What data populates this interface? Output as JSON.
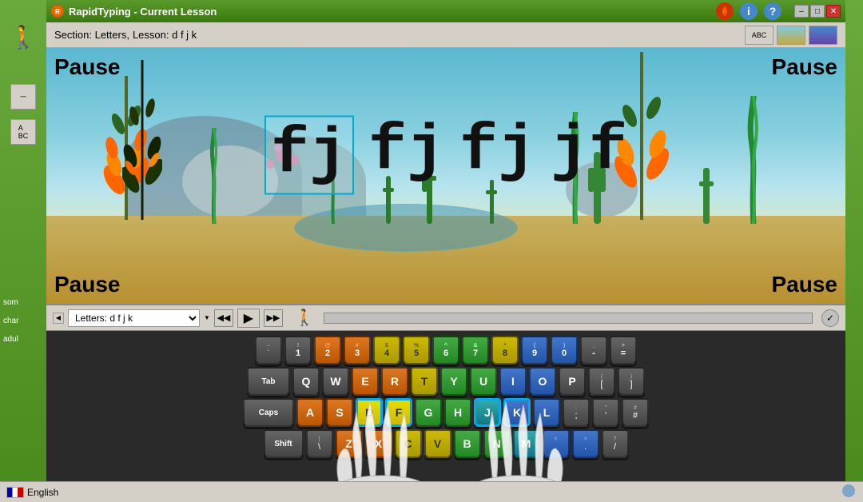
{
  "window": {
    "title": "RapidTyping - Current Lesson",
    "min": "–",
    "max": "□",
    "close": "✕"
  },
  "toolbar": {
    "section_label": "Section:  Letters,",
    "lesson_label": "Lesson: d f j k"
  },
  "scene": {
    "pause_labels": [
      "Pause",
      "Pause",
      "Pause",
      "Pause"
    ],
    "typing_words": [
      "fj",
      "fj",
      "fj",
      "jf"
    ]
  },
  "controls": {
    "lesson_value": "Letters: d f j k",
    "rewind": "◀◀",
    "play": "▶",
    "forward": "▶▶"
  },
  "keyboard": {
    "rows": [
      {
        "keys": [
          {
            "label": "~\n`",
            "top": "~",
            "main": "`",
            "color": "dark"
          },
          {
            "label": "!\n1",
            "top": "!",
            "main": "1",
            "color": "dark"
          },
          {
            "label": "@\n2",
            "top": "@",
            "main": "2",
            "color": "orange"
          },
          {
            "label": "#\n3",
            "top": "#",
            "main": "3",
            "color": "orange"
          },
          {
            "label": "$\n4",
            "top": "$",
            "main": "4",
            "color": "yellow"
          },
          {
            "label": "%\n5",
            "top": "%",
            "main": "5",
            "color": "yellow"
          },
          {
            "label": "^\n6",
            "top": "^",
            "main": "6",
            "color": "green"
          },
          {
            "label": "&\n7",
            "top": "&",
            "main": "7",
            "color": "green"
          },
          {
            "label": "*\n8",
            "top": "*",
            "main": "8",
            "color": "yellow"
          },
          {
            "label": "(\n9",
            "top": "(",
            "main": "9",
            "color": "blue"
          },
          {
            "label": ")\n0",
            "top": ")",
            "main": "0",
            "color": "blue"
          },
          {
            "label": "_\n-",
            "top": "_",
            "main": "-",
            "color": "dark"
          },
          {
            "label": "+\n=",
            "top": "+",
            "main": "=",
            "color": "dark"
          }
        ]
      },
      {
        "keys": [
          {
            "label": "Tab",
            "top": "",
            "main": "Tab",
            "color": "dark",
            "wide": true
          },
          {
            "label": "Q",
            "top": "",
            "main": "Q",
            "color": "dark"
          },
          {
            "label": "W",
            "top": "",
            "main": "W",
            "color": "dark"
          },
          {
            "label": "E",
            "top": "",
            "main": "E",
            "color": "orange"
          },
          {
            "label": "R",
            "top": "",
            "main": "R",
            "color": "orange"
          },
          {
            "label": "T",
            "top": "",
            "main": "T",
            "color": "yellow"
          },
          {
            "label": "Y",
            "top": "",
            "main": "Y",
            "color": "green"
          },
          {
            "label": "U",
            "top": "",
            "main": "U",
            "color": "green"
          },
          {
            "label": "I",
            "top": "",
            "main": "I",
            "color": "blue"
          },
          {
            "label": "O",
            "top": "",
            "main": "O",
            "color": "blue"
          },
          {
            "label": "P",
            "top": "",
            "main": "P",
            "color": "dark"
          },
          {
            "label": "[\n{",
            "top": "{",
            "main": "[",
            "color": "dark"
          },
          {
            "label": "]\n}",
            "top": "}",
            "main": "]",
            "color": "dark"
          }
        ]
      },
      {
        "keys": [
          {
            "label": "Caps",
            "top": "",
            "main": "Caps",
            "color": "dark",
            "wide": "caps"
          },
          {
            "label": "A",
            "top": "",
            "main": "A",
            "color": "orange"
          },
          {
            "label": "S",
            "top": "",
            "main": "S",
            "color": "orange"
          },
          {
            "label": "D",
            "top": "",
            "main": "D",
            "color": "yellow",
            "highlight": true
          },
          {
            "label": "F",
            "top": "",
            "main": "F",
            "color": "yellow",
            "highlight": true
          },
          {
            "label": "G",
            "top": "",
            "main": "G",
            "color": "green"
          },
          {
            "label": "H",
            "top": "",
            "main": "H",
            "color": "green"
          },
          {
            "label": "J",
            "top": "",
            "main": "J",
            "color": "teal",
            "highlight": true
          },
          {
            "label": "K",
            "top": "",
            "main": "K",
            "color": "blue",
            "highlight": true
          },
          {
            "label": "L",
            "top": "",
            "main": "L",
            "color": "blue"
          },
          {
            "label": ":\n;",
            "top": ":",
            "main": ";",
            "color": "dark"
          },
          {
            "label": "\"\n'",
            "top": "\"",
            "main": "'",
            "color": "dark"
          },
          {
            "label": "#\n~",
            "top": "#",
            "main": "#",
            "color": "dark"
          }
        ]
      },
      {
        "keys": [
          {
            "label": "Shift",
            "top": "",
            "main": "Shift",
            "color": "dark",
            "wide": "shift"
          },
          {
            "label": "|\n\\",
            "top": "|",
            "main": "\\",
            "color": "dark"
          },
          {
            "label": "Z",
            "top": "",
            "main": "Z",
            "color": "orange"
          },
          {
            "label": "X",
            "top": "",
            "main": "X",
            "color": "orange"
          },
          {
            "label": "C",
            "top": "",
            "main": "C",
            "color": "yellow"
          },
          {
            "label": "V",
            "top": "",
            "main": "V",
            "color": "yellow"
          },
          {
            "label": "B",
            "top": "",
            "main": "B",
            "color": "green"
          },
          {
            "label": "N",
            "top": "",
            "main": "N",
            "color": "green"
          },
          {
            "label": "M",
            "top": "",
            "main": "M",
            "color": "teal"
          },
          {
            "label": "<\n,",
            "top": "<",
            "main": ",",
            "color": "blue"
          },
          {
            "label": ">\n.",
            "top": ">",
            "main": ".",
            "color": "blue"
          },
          {
            "label": "?\n/",
            "top": "?",
            "main": "/",
            "color": "dark"
          }
        ]
      }
    ]
  },
  "status": {
    "language": "English",
    "flag_colors": [
      "#ffffff",
      "#cc0000"
    ]
  }
}
